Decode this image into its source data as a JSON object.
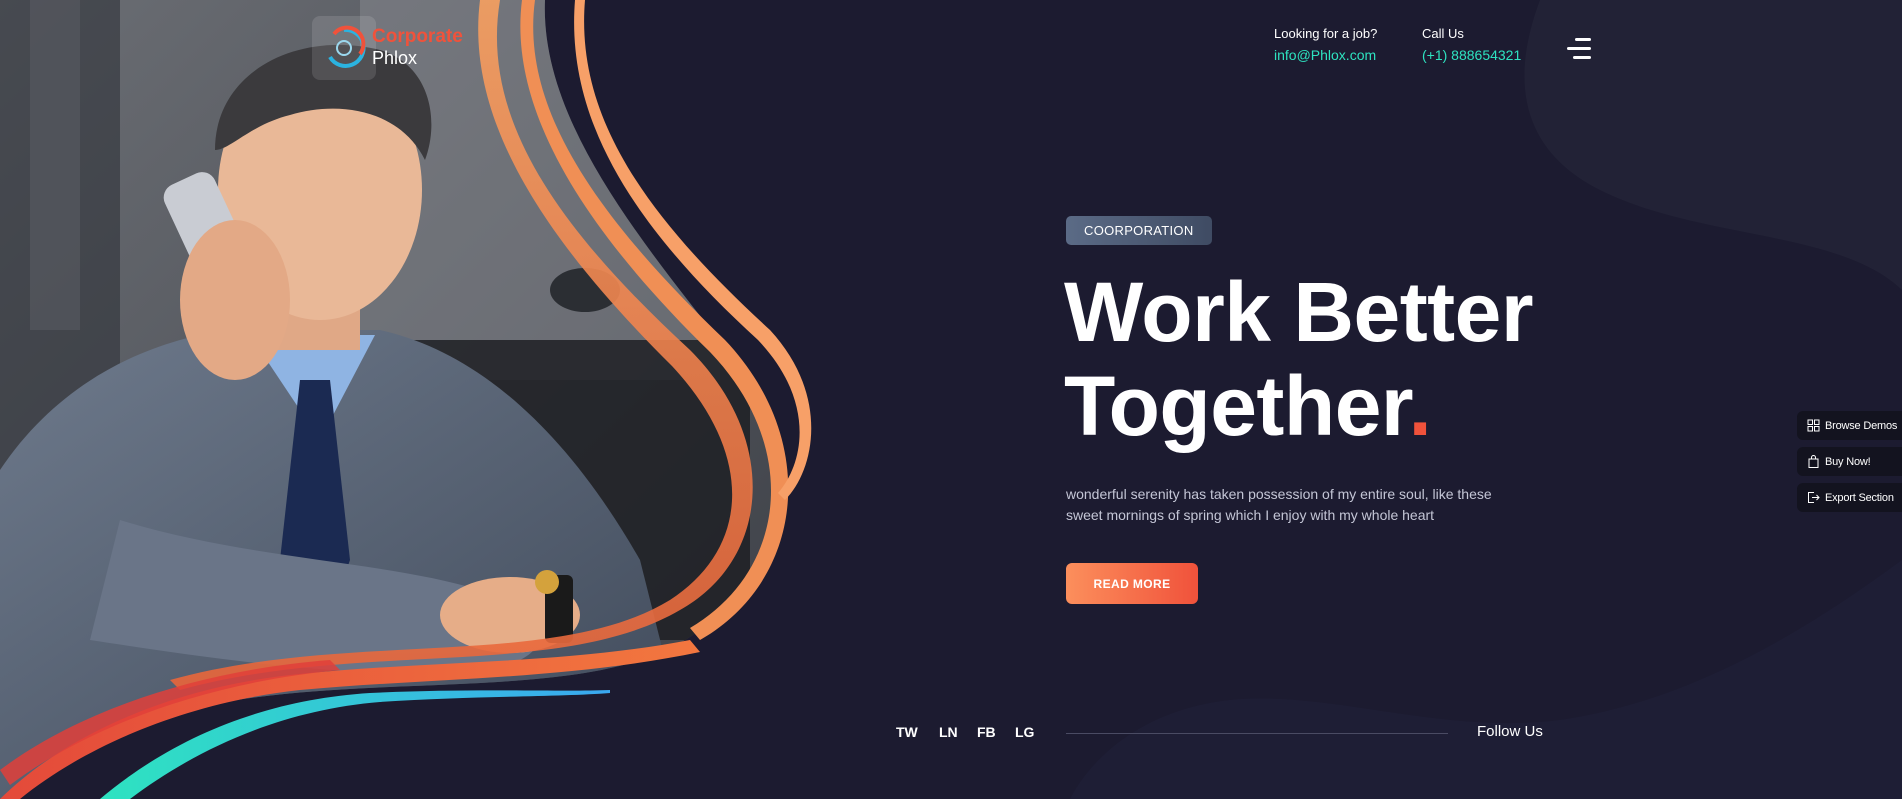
{
  "brand": {
    "line1": "Corporate",
    "line2": "Phlox"
  },
  "header": {
    "job": {
      "label": "Looking for a job?",
      "value": "info@Phlox.com"
    },
    "call": {
      "label": "Call Us",
      "value": "(+1) 888654321"
    }
  },
  "hero": {
    "tag": "COORPORATION",
    "headline_line1": "Work Better",
    "headline_line2": "Together",
    "headline_dot": ".",
    "description": "wonderful serenity has taken possession of my entire soul, like these sweet mornings of spring which I enjoy with my whole heart",
    "cta": "READ MORE"
  },
  "social": {
    "links": [
      "TW",
      "LN",
      "FB",
      "LG"
    ],
    "follow_label": "Follow Us"
  },
  "dock": {
    "items": [
      {
        "label": "Browse Demos",
        "icon": "grid-icon"
      },
      {
        "label": "Buy Now!",
        "icon": "bag-icon"
      },
      {
        "label": "Export Section",
        "icon": "export-icon"
      }
    ]
  },
  "colors": {
    "background": "#1c1b30",
    "accent": "#f0523b",
    "accent_gradient_start": "#fc8f5c",
    "link": "#2ee3c0"
  }
}
